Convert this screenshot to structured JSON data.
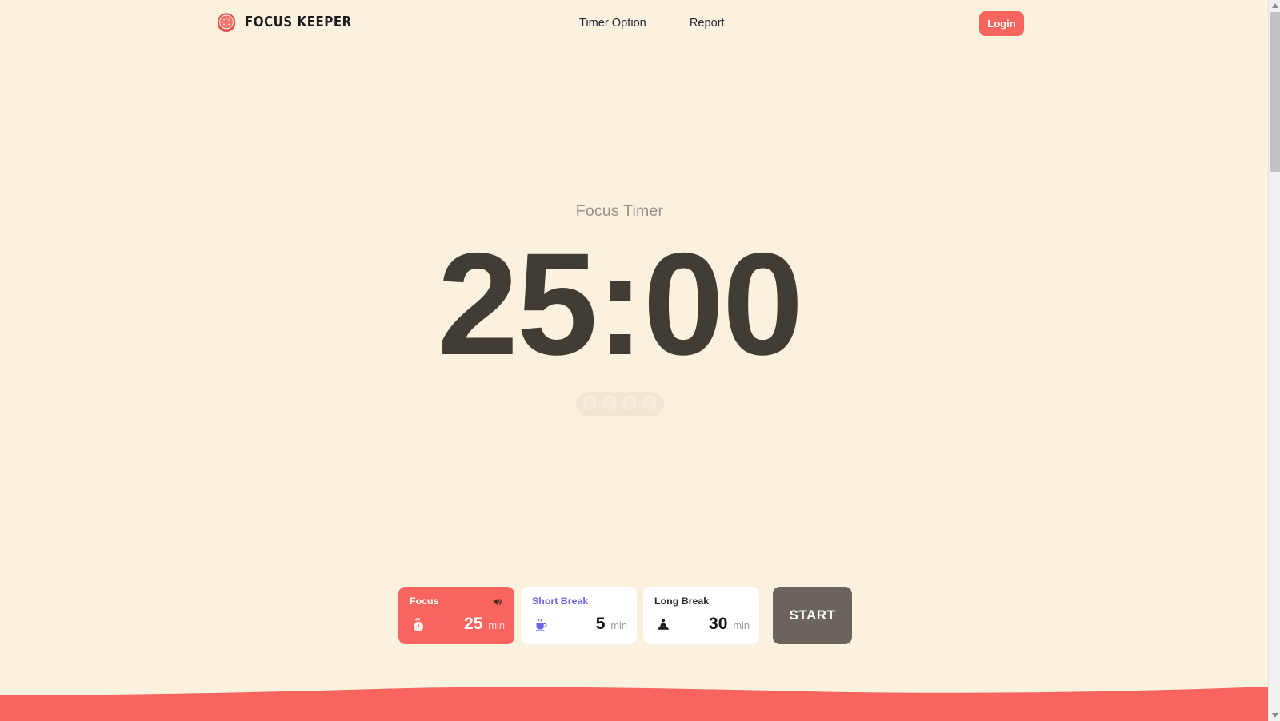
{
  "header": {
    "brand_name": "FOCUS KEEPER",
    "brand_icon": "tomato-logo-icon",
    "nav": [
      {
        "label": "Timer Option",
        "name": "nav-timer-option"
      },
      {
        "label": "Report",
        "name": "nav-report"
      }
    ],
    "login_label": "Login",
    "login_color": "#F8655F"
  },
  "timer": {
    "label": "Focus Timer",
    "display": "25:00",
    "display_color": "#413C34",
    "label_color": "#9A9086",
    "rounds": {
      "total": 4,
      "completed": 0,
      "icon": "tomato-slice-icon",
      "pill_color": "#F1E7D5"
    }
  },
  "controls": {
    "modes": [
      {
        "name": "focus",
        "title": "Focus",
        "value": "25",
        "unit": "min",
        "glyph": "tomato-icon",
        "active": true,
        "bg": "#F8655F",
        "title_color": "#FFFFFF",
        "sound_icon": "speaker-on-icon"
      },
      {
        "name": "short-break",
        "title": "Short Break",
        "value": "5",
        "unit": "min",
        "glyph": "coffee-cup-icon",
        "active": false,
        "bg": "#FFFFFF",
        "title_color": "#6C63E8"
      },
      {
        "name": "long-break",
        "title": "Long Break",
        "value": "30",
        "unit": "min",
        "glyph": "meditation-icon",
        "active": false,
        "bg": "#FFFFFF",
        "title_color": "#2B2B2B"
      }
    ],
    "start_label": "START",
    "start_color": "#6B645D"
  },
  "decoration": {
    "wave_color": "#F8655F",
    "page_background": "#FBF1DF"
  },
  "scrollbar": {
    "up_arrow": "▲",
    "down_arrow": "▼"
  }
}
